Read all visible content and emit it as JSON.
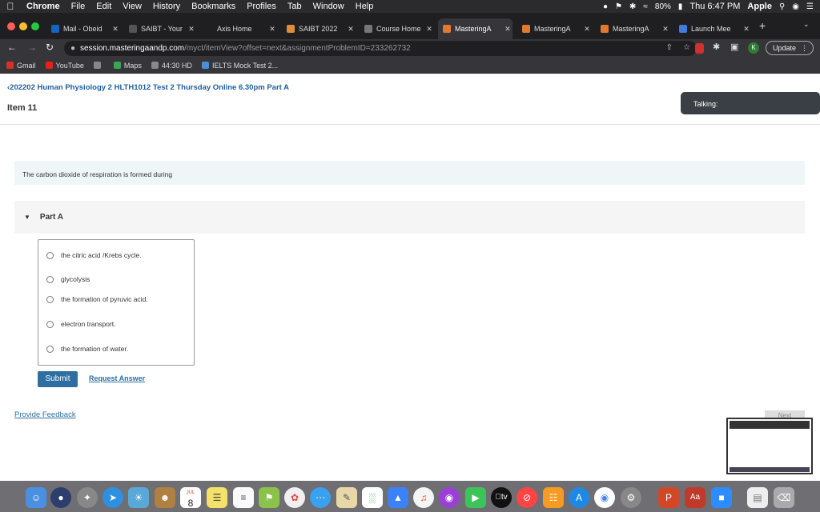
{
  "menubar": {
    "app": "Chrome",
    "items": [
      "File",
      "Edit",
      "View",
      "History",
      "Bookmarks",
      "Profiles",
      "Tab",
      "Window",
      "Help"
    ],
    "battery": "80%",
    "clock": "Thu 6:47 PM",
    "user": "Apple"
  },
  "tabs": [
    {
      "label": "Mail - Obeid",
      "color": "#1565c0"
    },
    {
      "label": "SAIBT - Your",
      "color": "#555555"
    },
    {
      "label": "Axis Home",
      "color": "#1f1f22"
    },
    {
      "label": "SAIBT 2022",
      "color": "#e08a3c"
    },
    {
      "label": "Course Home",
      "color": "#777777"
    },
    {
      "label": "MasteringA",
      "color": "#e07a30"
    },
    {
      "label": "MasteringA",
      "color": "#e07a30"
    },
    {
      "label": "MasteringA",
      "color": "#e07a30"
    },
    {
      "label": "Launch Mee",
      "color": "#3f7ae0"
    }
  ],
  "url": {
    "host": "session.masteringaandp.com",
    "path": "/myct/itemView?offset=next&assignmentProblemID=233262732"
  },
  "toolbar": {
    "update_label": "Update"
  },
  "bookmarks": [
    {
      "label": "Gmail",
      "color": "#d93025"
    },
    {
      "label": "YouTube",
      "color": "#e62117"
    },
    {
      "label": "",
      "color": "#888888"
    },
    {
      "label": "Maps",
      "color": "#34a853"
    },
    {
      "label": "44:30 HD",
      "color": "#888888"
    },
    {
      "label": "IELTS Mock Test 2...",
      "color": "#4a90d9"
    }
  ],
  "page": {
    "breadcrumb": "202202 Human Physiology 2 HLTH1012 Test 2 Thursday Online 6.30pm Part A",
    "item_title": "Item 11",
    "talking": "Talking:",
    "question": "The carbon dioxide of respiration is formed during",
    "part_label": "Part A",
    "choices": [
      "the citric acid /Krebs cycle.",
      "glycolysis",
      "the formation of pyruvic acid.",
      "electron transport.",
      "the formation of water."
    ],
    "submit_label": "Submit",
    "request_answer": "Request Answer",
    "feedback": "Provide Feedback",
    "next_label": "Next"
  },
  "dock": {
    "calendar_day": "8",
    "calendar_month": "JUL",
    "appletv": "tv"
  }
}
